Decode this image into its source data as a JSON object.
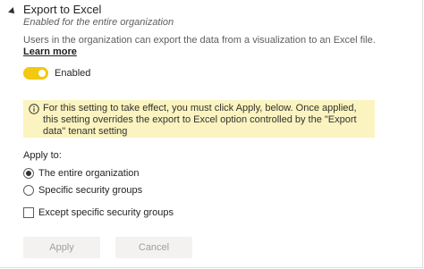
{
  "setting": {
    "title": "Export to Excel",
    "subtitle": "Enabled for the entire organization",
    "description": "Users in the organization can export the data from a visualization to an Excel file.",
    "learn_more_label": "Learn more"
  },
  "toggle": {
    "label": "Enabled",
    "state": "on",
    "color": "#f2c811"
  },
  "warning": {
    "icon": "info-icon",
    "text": "For this setting to take effect, you must click Apply, below. Once applied, this setting overrides the export to Excel option controlled by the \"Export data\" tenant setting",
    "background": "#fbf4c0"
  },
  "apply_to": {
    "label": "Apply to:",
    "options": [
      {
        "label": "The entire organization",
        "selected": true
      },
      {
        "label": "Specific security groups",
        "selected": false
      }
    ],
    "except_label": "Except specific security groups",
    "except_checked": false
  },
  "buttons": {
    "apply_label": "Apply",
    "cancel_label": "Cancel"
  }
}
